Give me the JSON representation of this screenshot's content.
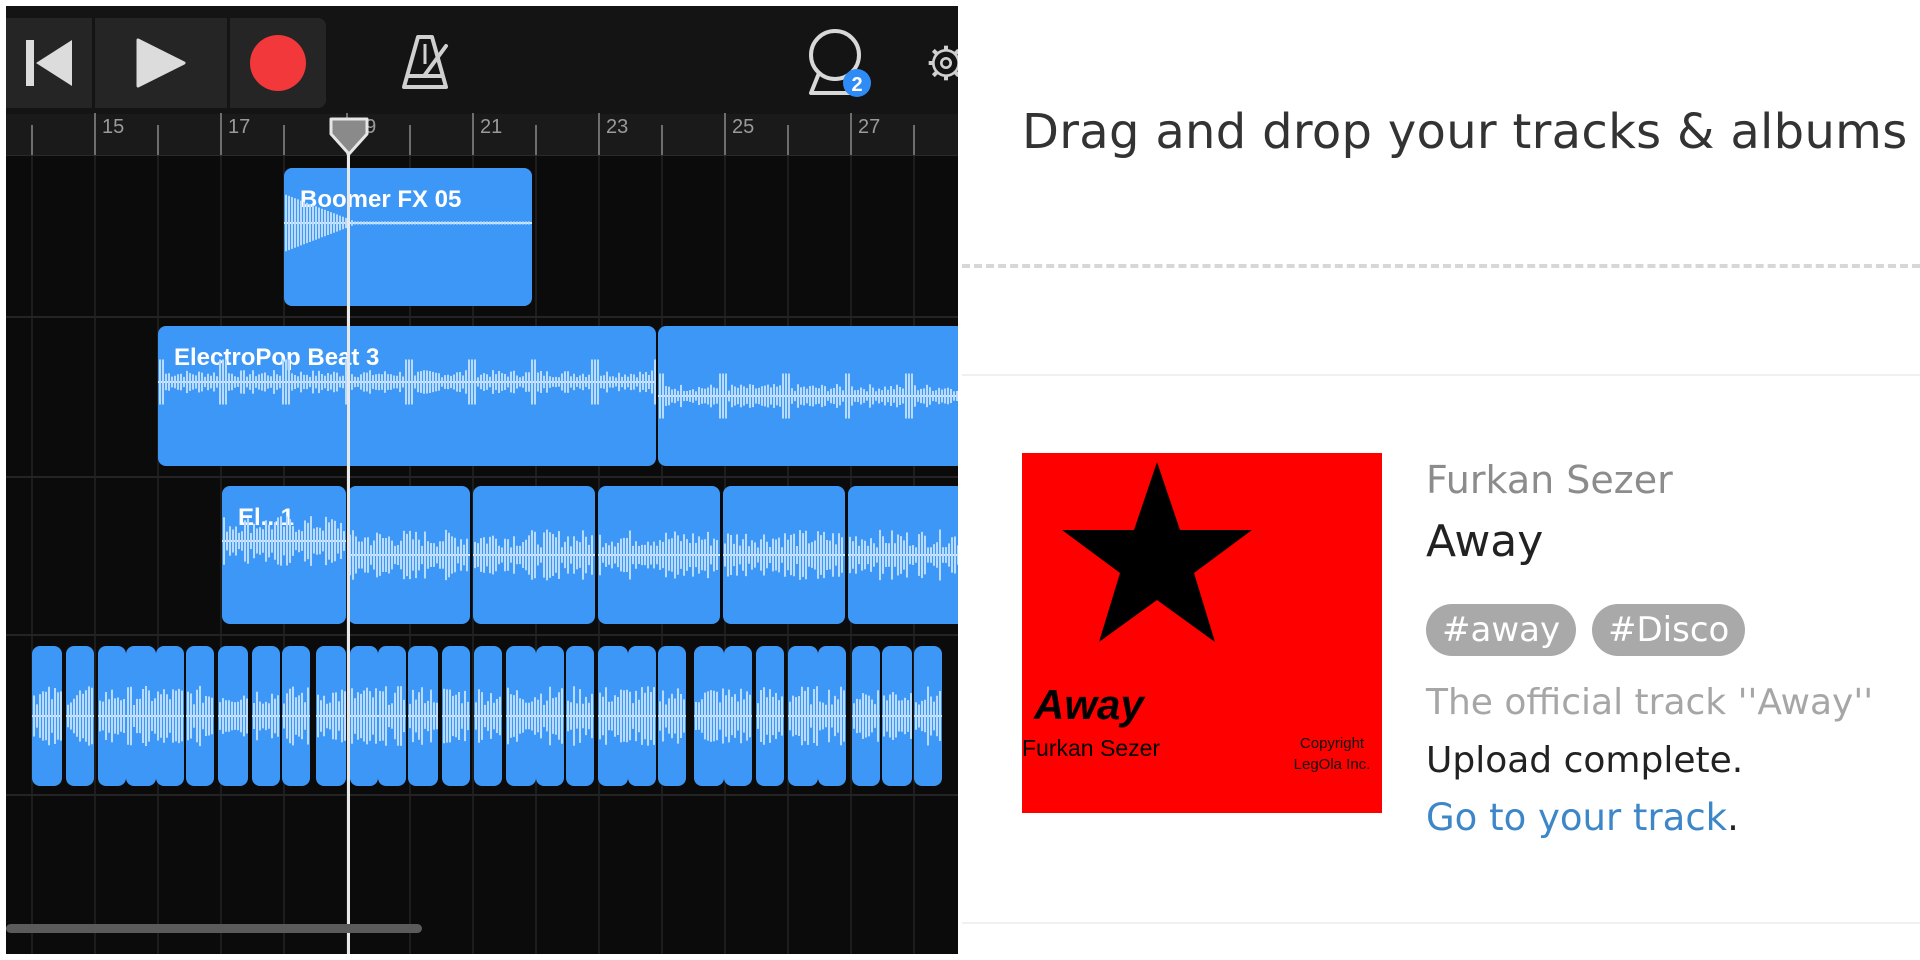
{
  "colors": {
    "region_blue": "#3d97f6",
    "record_red": "#f2383a",
    "badge_blue": "#2f8cf6",
    "link_blue": "#3d87c9",
    "tag_gray": "#a9a9a9",
    "cover_red": "#fe0000"
  },
  "daw": {
    "toolbar": {
      "rewind_icon": "rewind-to-start-icon",
      "play_icon": "play-icon",
      "record_icon": "record-icon",
      "metronome_icon": "metronome-icon",
      "loop_icon": "loop-browser-icon",
      "loop_badge": "2",
      "settings_icon": "gear-icon"
    },
    "ruler": {
      "bar_numbers": [
        "15",
        "17",
        "19",
        "21",
        "23",
        "25",
        "27"
      ]
    },
    "regions": [
      {
        "name": "Boomer FX 05"
      },
      {
        "name": "ElectroPop Beat 3"
      },
      {
        "name": "El...1"
      },
      {
        "name": ""
      }
    ]
  },
  "upload": {
    "drop_text": "Drag and drop your tracks & albums h",
    "cover": {
      "title": "Away",
      "artist": "Furkan Sezer",
      "copyright": "Copyright LegOla Inc."
    },
    "artist": "Furkan Sezer",
    "title": "Away",
    "tags": [
      "#away",
      "#Disco"
    ],
    "description": "The official track ''Away''",
    "status": "Upload complete.",
    "go_to_link": "Go to your track",
    "go_to_suffix": "."
  }
}
